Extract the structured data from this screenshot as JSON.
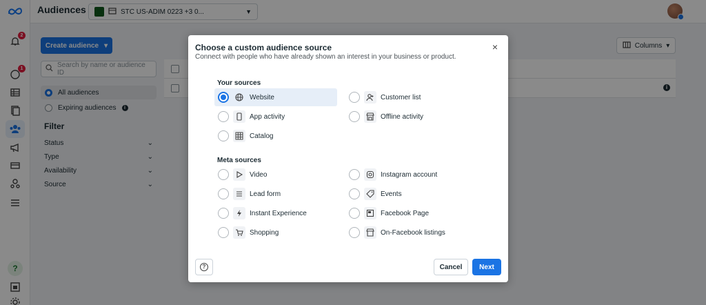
{
  "app": {
    "title": "Audiences",
    "logo_icon": "meta-logo-icon"
  },
  "topbar": {
    "account_label": "STC US-ADIM 0223 +3 0...",
    "account_icon": "ad-account-icon"
  },
  "rail": {
    "notifications_badge": "2",
    "alerts_badge": "1",
    "help_glyph": "?"
  },
  "left_panel": {
    "create_button": "Create audience",
    "search_placeholder": "Search by name or audience ID",
    "radios": [
      {
        "label": "All audiences",
        "selected": true
      },
      {
        "label": "Expiring audiences",
        "selected": false
      }
    ],
    "filter_heading": "Filter",
    "filters": [
      "Status",
      "Type",
      "Availability",
      "Source"
    ]
  },
  "table": {
    "columns_button": "Columns"
  },
  "modal": {
    "title": "Choose a custom audience source",
    "subtitle": "Connect with people who have already shown an interest in your business or product.",
    "your_sources_label": "Your sources",
    "your_sources": [
      {
        "label": "Website",
        "icon": "globe-icon",
        "selected": true
      },
      {
        "label": "Customer list",
        "icon": "customer-list-icon",
        "selected": false
      },
      {
        "label": "App activity",
        "icon": "mobile-icon",
        "selected": false
      },
      {
        "label": "Offline activity",
        "icon": "store-icon",
        "selected": false
      },
      {
        "label": "Catalog",
        "icon": "catalog-grid-icon",
        "selected": false
      }
    ],
    "meta_sources_label": "Meta sources",
    "meta_sources": [
      {
        "label": "Video",
        "icon": "play-icon"
      },
      {
        "label": "Instagram account",
        "icon": "instagram-icon"
      },
      {
        "label": "Lead form",
        "icon": "lead-form-icon"
      },
      {
        "label": "Events",
        "icon": "tag-icon"
      },
      {
        "label": "Instant Experience",
        "icon": "lightning-icon"
      },
      {
        "label": "Facebook Page",
        "icon": "page-icon"
      },
      {
        "label": "Shopping",
        "icon": "cart-icon"
      },
      {
        "label": "On-Facebook listings",
        "icon": "listing-icon"
      }
    ],
    "cancel_label": "Cancel",
    "next_label": "Next",
    "close_glyph": "×"
  }
}
